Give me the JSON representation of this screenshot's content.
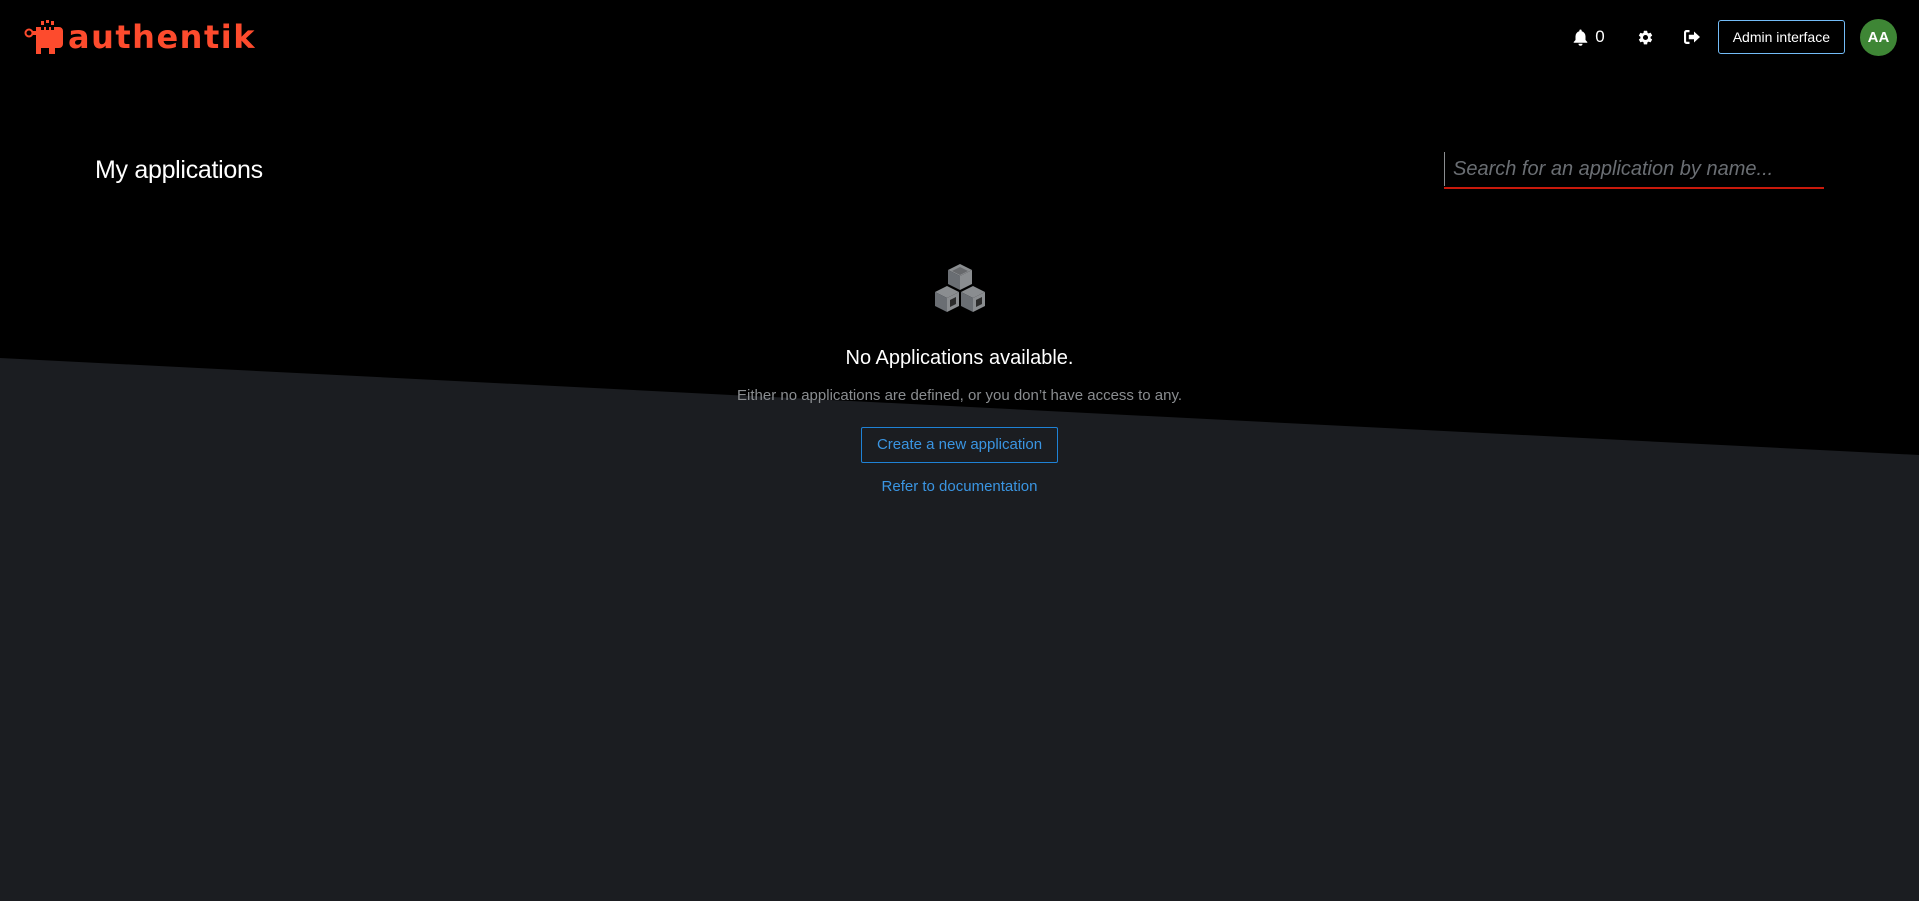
{
  "brand": {
    "name": "authentik",
    "color": "#fd4b2d"
  },
  "header": {
    "notifications": {
      "icon": "bell-icon",
      "count": "0"
    },
    "settings_icon": "gear-icon",
    "logout_icon": "sign-out-icon",
    "admin_button_label": "Admin interface",
    "avatar_initials": "AA",
    "avatar_color": "#3e8635"
  },
  "main": {
    "title": "My applications",
    "search": {
      "placeholder": "Search for an application by name...",
      "value": ""
    },
    "empty_state": {
      "icon": "cubes-icon",
      "title": "No Applications available.",
      "body": "Either no applications are defined, or you don’t have access to any.",
      "primary_action_label": "Create a new application",
      "secondary_action_label": "Refer to documentation"
    }
  },
  "colors": {
    "header_background": "#000000",
    "page_background": "#1b1d21",
    "link": "#3a95e2",
    "search_underline": "#c9190b"
  }
}
